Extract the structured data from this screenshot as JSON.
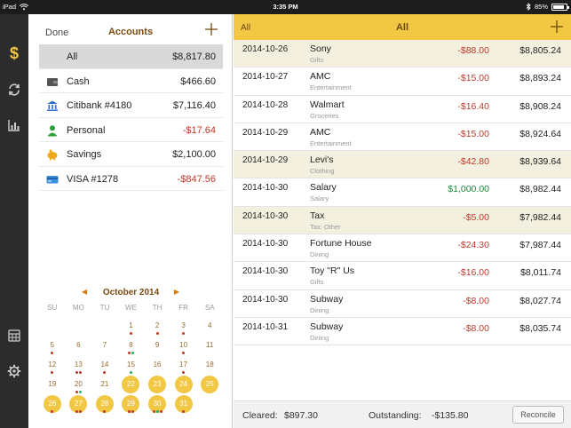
{
  "status_bar": {
    "device": "iPad",
    "time": "3:35 PM",
    "battery": "85%",
    "battery_level": 0.85
  },
  "toolbar": {
    "items": [
      {
        "icon": "dollar-icon",
        "active": true
      },
      {
        "icon": "sync-icon"
      },
      {
        "icon": "bar-chart-icon"
      },
      {
        "icon": "calculator-icon"
      },
      {
        "icon": "gear-icon"
      }
    ]
  },
  "accounts": {
    "done_label": "Done",
    "title": "Accounts",
    "add_icon": "plus-icon",
    "items": [
      {
        "name": "All",
        "amount": "$8,817.80",
        "selected": true,
        "icon": ""
      },
      {
        "name": "Cash",
        "amount": "$466.60",
        "icon": "wallet-icon"
      },
      {
        "name": "Citibank #4180",
        "amount": "$7,116.40",
        "icon": "bank-icon"
      },
      {
        "name": "Personal",
        "amount": "-$17.64",
        "negative": true,
        "icon": "person-icon"
      },
      {
        "name": "Savings",
        "amount": "$2,100.00",
        "icon": "piggy-bank-icon"
      },
      {
        "name": "VISA #1278",
        "amount": "-$847.56",
        "negative": true,
        "icon": "credit-card-icon"
      }
    ]
  },
  "calendar": {
    "month": "October 2014",
    "weekdays": [
      "SU",
      "MO",
      "TU",
      "WE",
      "TH",
      "FR",
      "SA"
    ],
    "days": [
      {
        "d": ""
      },
      {
        "d": ""
      },
      {
        "d": ""
      },
      {
        "d": "1",
        "dots": "r"
      },
      {
        "d": "2",
        "dots": "r"
      },
      {
        "d": "3",
        "dots": "r"
      },
      {
        "d": "4"
      },
      {
        "d": "5",
        "dots": "r"
      },
      {
        "d": "6"
      },
      {
        "d": "7"
      },
      {
        "d": "8",
        "dots": "rg"
      },
      {
        "d": "9"
      },
      {
        "d": "10",
        "dots": "r"
      },
      {
        "d": "11"
      },
      {
        "d": "12",
        "dots": "r"
      },
      {
        "d": "13",
        "dots": "rr"
      },
      {
        "d": "14",
        "dots": "r"
      },
      {
        "d": "15",
        "dots": "g"
      },
      {
        "d": "16"
      },
      {
        "d": "17",
        "dots": "r"
      },
      {
        "d": "18"
      },
      {
        "d": "19"
      },
      {
        "d": "20",
        "dots": "rg"
      },
      {
        "d": "21"
      },
      {
        "d": "22",
        "hl": true
      },
      {
        "d": "23",
        "hl": true
      },
      {
        "d": "24",
        "hl": true
      },
      {
        "d": "25",
        "hl": true
      },
      {
        "d": "26",
        "hl": true,
        "dots": "r"
      },
      {
        "d": "27",
        "hl": true,
        "dots": "rr"
      },
      {
        "d": "28",
        "hl": true,
        "dots": "r"
      },
      {
        "d": "29",
        "hl": true,
        "dots": "rr"
      },
      {
        "d": "30",
        "hl": true,
        "dots": "rgr"
      },
      {
        "d": "31",
        "hl": true,
        "dots": "r"
      }
    ]
  },
  "transactions": {
    "filter_label": "All",
    "title": "All",
    "rows": [
      {
        "date": "2014-10-26",
        "payee": "Sony",
        "category": "Gifts",
        "amount": "-$88.00",
        "balance": "$8,805.24",
        "alt": true
      },
      {
        "date": "2014-10-27",
        "payee": "AMC",
        "category": "Entertainment",
        "amount": "-$15.00",
        "balance": "$8,893.24"
      },
      {
        "date": "2014-10-28",
        "payee": "Walmart",
        "category": "Groceries",
        "amount": "-$16.40",
        "balance": "$8,908.24"
      },
      {
        "date": "2014-10-29",
        "payee": "AMC",
        "category": "Entertainment",
        "amount": "-$15.00",
        "balance": "$8,924.64"
      },
      {
        "date": "2014-10-29",
        "payee": "Levi's",
        "category": "Clothing",
        "amount": "-$42.80",
        "balance": "$8,939.64",
        "alt": true
      },
      {
        "date": "2014-10-30",
        "payee": "Salary",
        "category": "Salary",
        "amount": "$1,000.00",
        "balance": "$8,982.44",
        "positive": true
      },
      {
        "date": "2014-10-30",
        "payee": "Tax",
        "category": "Tax: Other",
        "amount": "-$5.00",
        "balance": "$7,982.44",
        "alt": true
      },
      {
        "date": "2014-10-30",
        "payee": "Fortune House",
        "category": "Dining",
        "amount": "-$24.30",
        "balance": "$7,987.44"
      },
      {
        "date": "2014-10-30",
        "payee": "Toy \"R\" Us",
        "category": "Gifts",
        "amount": "-$16.00",
        "balance": "$8,011.74"
      },
      {
        "date": "2014-10-30",
        "payee": "Subway",
        "category": "Dining",
        "amount": "-$8.00",
        "balance": "$8,027.74"
      },
      {
        "date": "2014-10-31",
        "payee": "Subway",
        "category": "Dining",
        "amount": "-$8.00",
        "balance": "$8,035.74"
      }
    ],
    "footer": {
      "cleared_label": "Cleared:",
      "cleared_value": "$897.30",
      "outstanding_label": "Outstanding:",
      "outstanding_value": "-$135.80",
      "reconcile_label": "Reconcile"
    }
  },
  "colors": {
    "accent": "#f2c744",
    "negative": "#c0392b",
    "positive": "#1a8a3a",
    "toolbar": "#2c2c2c"
  }
}
